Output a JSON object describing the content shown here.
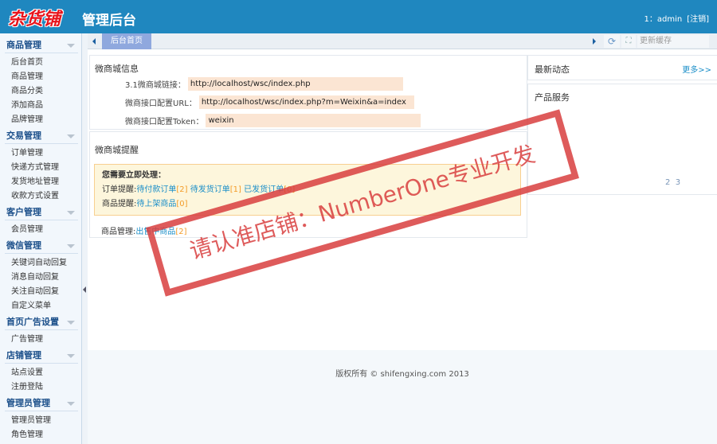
{
  "header": {
    "logo": "杂货铺",
    "title": "管理后台",
    "user": "1：admin",
    "logout": "[注销]"
  },
  "sidebar": {
    "groups": [
      {
        "title": "商品管理",
        "items": [
          "后台首页",
          "商品管理",
          "商品分类",
          "添加商品",
          "品牌管理"
        ]
      },
      {
        "title": "交易管理",
        "items": [
          "订单管理",
          "快递方式管理",
          "发货地址管理",
          "收款方式设置"
        ]
      },
      {
        "title": "客户管理",
        "items": [
          "会员管理"
        ]
      },
      {
        "title": "微信管理",
        "items": [
          "关键词自动回复",
          "消息自动回复",
          "关注自动回复",
          "自定义菜单"
        ]
      },
      {
        "title": "首页广告设置",
        "items": [
          "广告管理"
        ]
      },
      {
        "title": "店铺管理",
        "items": [
          "站点设置",
          "注册登陆"
        ]
      },
      {
        "title": "管理员管理",
        "items": [
          "管理员管理",
          "角色管理"
        ]
      }
    ]
  },
  "tabbar": {
    "tab": "后台首页",
    "refresh": "⟳",
    "fullscreen": "⛶",
    "cache": "更新缓存"
  },
  "info": {
    "title": "微商城信息",
    "rows": [
      {
        "label": "3.1微商城链接：",
        "value": "http://localhost/wsc/index.php"
      },
      {
        "label": "微商接口配置URL：",
        "value": "http://localhost/wsc/index.php?m=Weixin&a=index"
      },
      {
        "label": "微商接口配置Token：",
        "value": "weixin"
      }
    ]
  },
  "remind": {
    "title": "微商城提醒",
    "heading": "您需要立即处理：",
    "order_label": "订单提醒:",
    "orders": [
      {
        "name": "待付款订单",
        "count": "[2]"
      },
      {
        "name": "待发货订单",
        "count": "[1]"
      },
      {
        "name": "已发货订单",
        "count": "[0]"
      }
    ],
    "goods_label": "商品提醒:",
    "goods": {
      "name": "待上架商品",
      "count": "[0]"
    },
    "manage_label": "商品管理:",
    "manage": {
      "name": "出售中商品",
      "count": "[2]"
    }
  },
  "news": {
    "title": "最新动态",
    "more": "更多>>"
  },
  "service": {
    "title": "产品服务",
    "pages": [
      "2",
      "3"
    ]
  },
  "footer": "版权所有 © shifengxing.com 2013",
  "watermark": "请认准店铺：NumberOne专业开发"
}
